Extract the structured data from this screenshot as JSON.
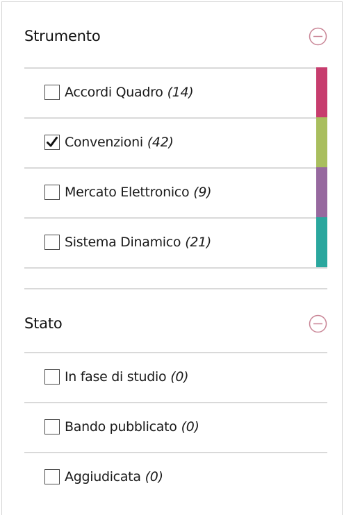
{
  "sections": [
    {
      "title": "Strumento",
      "items": [
        {
          "label": "Accordi Quadro",
          "count": "(14)",
          "checked": false,
          "color": "#c73d6e"
        },
        {
          "label": "Convenzioni",
          "count": "(42)",
          "checked": true,
          "color": "#a9be5e"
        },
        {
          "label": "Mercato Elettronico",
          "count": "(9)",
          "checked": false,
          "color": "#97699f"
        },
        {
          "label": "Sistema Dinamico",
          "count": "(21)",
          "checked": false,
          "color": "#2aa79e"
        }
      ]
    },
    {
      "title": "Stato",
      "items": [
        {
          "label": "In fase di studio",
          "count": "(0)",
          "checked": false
        },
        {
          "label": "Bando pubblicato",
          "count": "(0)",
          "checked": false
        },
        {
          "label": "Aggiudicata",
          "count": "(0)",
          "checked": false
        }
      ]
    }
  ],
  "colors": {
    "collapse_icon": "#c98596",
    "separator": "#d9d9d9",
    "checkbox_border": "#4a4a4a"
  }
}
